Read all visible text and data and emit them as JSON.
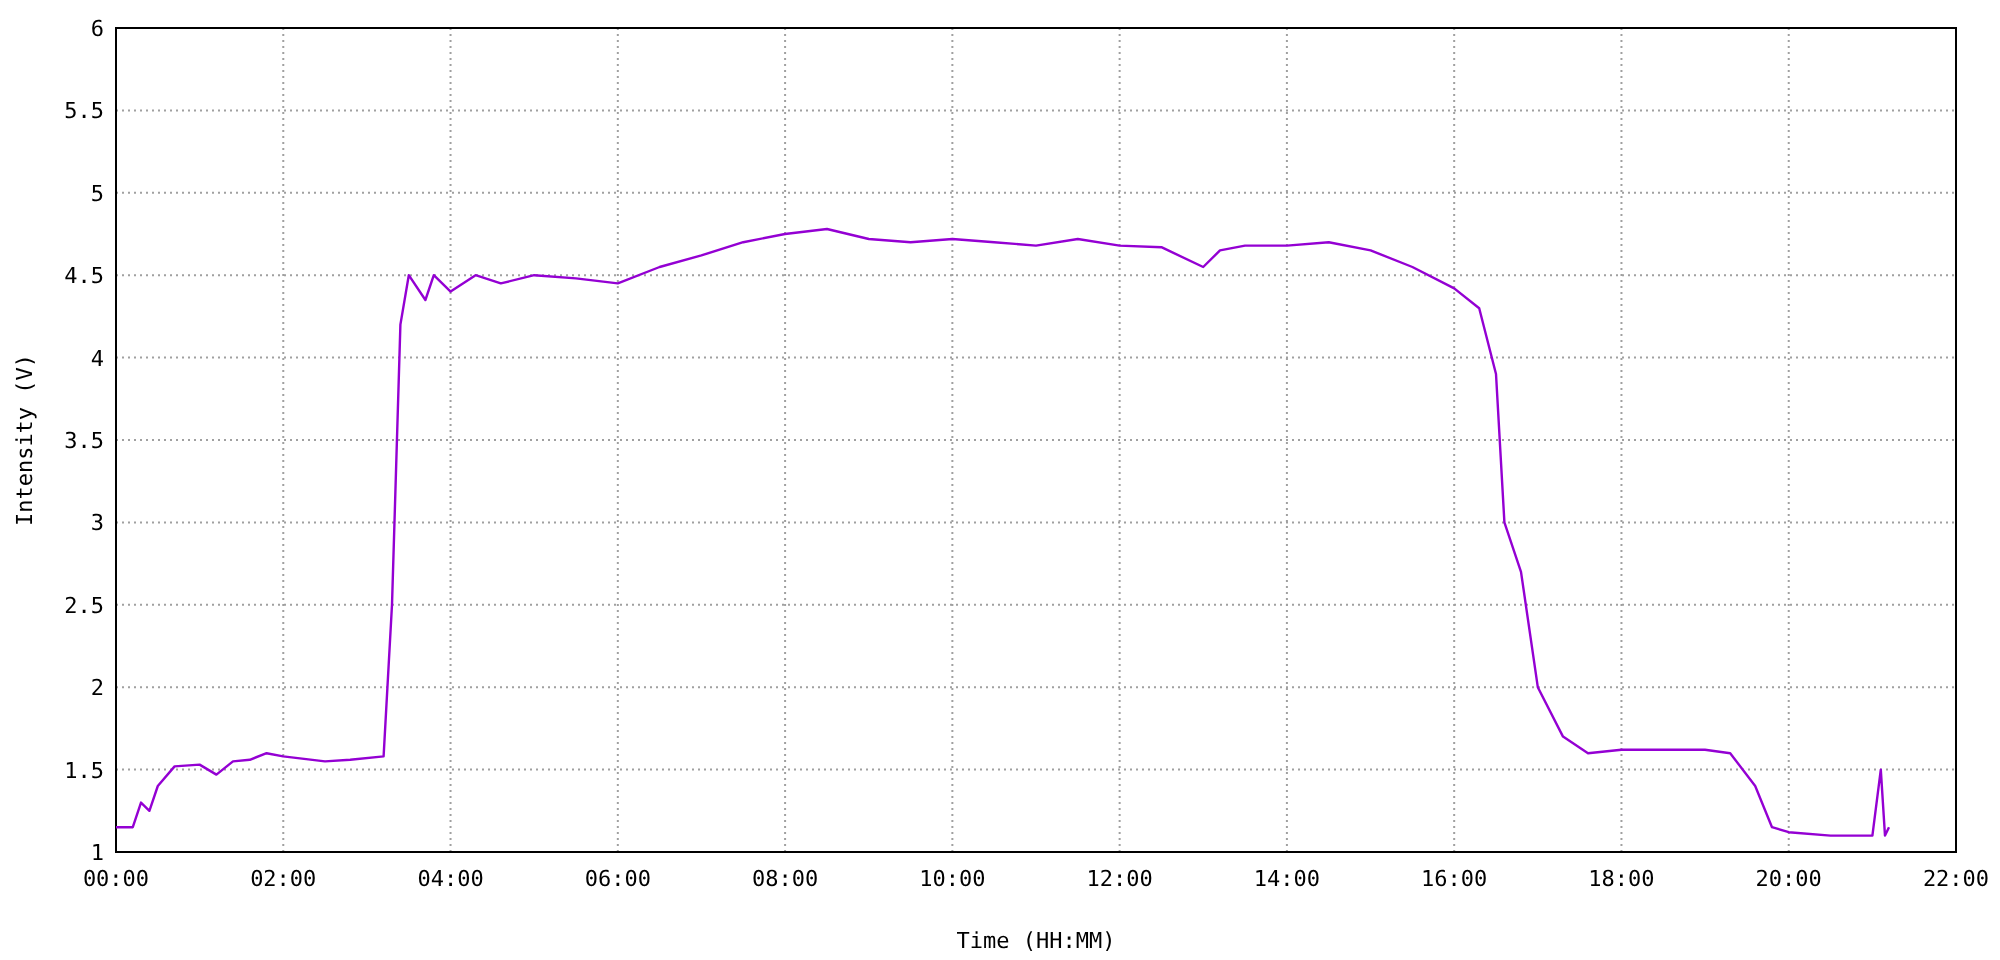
{
  "chart_data": {
    "type": "line",
    "xlabel": "Time (HH:MM)",
    "ylabel": "Intensity (V)",
    "xlim": [
      0,
      22
    ],
    "ylim": [
      1,
      6
    ],
    "xticks": [
      {
        "value": 0,
        "label": "00:00"
      },
      {
        "value": 2,
        "label": "02:00"
      },
      {
        "value": 4,
        "label": "04:00"
      },
      {
        "value": 6,
        "label": "06:00"
      },
      {
        "value": 8,
        "label": "08:00"
      },
      {
        "value": 10,
        "label": "10:00"
      },
      {
        "value": 12,
        "label": "12:00"
      },
      {
        "value": 14,
        "label": "14:00"
      },
      {
        "value": 16,
        "label": "16:00"
      },
      {
        "value": 18,
        "label": "18:00"
      },
      {
        "value": 20,
        "label": "20:00"
      },
      {
        "value": 22,
        "label": "22:00"
      }
    ],
    "grid": true,
    "yticks": [
      1,
      1.5,
      2,
      2.5,
      3,
      3.5,
      4,
      4.5,
      5,
      5.5,
      6
    ],
    "x": [
      0,
      0.2,
      0.3,
      0.4,
      0.5,
      0.7,
      1.0,
      1.2,
      1.4,
      1.6,
      1.8,
      2.0,
      2.5,
      2.8,
      3.2,
      3.3,
      3.4,
      3.5,
      3.7,
      3.8,
      4.0,
      4.3,
      4.6,
      5.0,
      5.5,
      6.0,
      6.5,
      7.0,
      7.5,
      8.0,
      8.5,
      9.0,
      9.5,
      10.0,
      10.5,
      11.0,
      11.5,
      12.0,
      12.5,
      13.0,
      13.2,
      13.5,
      14.0,
      14.5,
      15.0,
      15.5,
      16.0,
      16.3,
      16.5,
      16.6,
      16.8,
      17.0,
      17.3,
      17.6,
      18.0,
      18.5,
      19.0,
      19.3,
      19.6,
      19.8,
      20.0,
      20.5,
      21.0,
      21.1,
      21.15,
      21.2
    ],
    "series": [
      {
        "color": "#9400d3",
        "values": [
          1.15,
          1.15,
          1.3,
          1.25,
          1.4,
          1.52,
          1.53,
          1.47,
          1.55,
          1.56,
          1.6,
          1.58,
          1.55,
          1.56,
          1.58,
          2.5,
          4.2,
          4.5,
          4.35,
          4.5,
          4.4,
          4.5,
          4.45,
          4.5,
          4.48,
          4.45,
          4.55,
          4.62,
          4.7,
          4.75,
          4.78,
          4.72,
          4.7,
          4.72,
          4.7,
          4.68,
          4.72,
          4.68,
          4.67,
          4.55,
          4.65,
          4.68,
          4.68,
          4.7,
          4.65,
          4.55,
          4.42,
          4.3,
          3.9,
          3.0,
          2.7,
          2.0,
          1.7,
          1.6,
          1.62,
          1.62,
          1.62,
          1.6,
          1.4,
          1.15,
          1.12,
          1.1,
          1.1,
          1.5,
          1.1,
          1.15
        ]
      }
    ]
  }
}
